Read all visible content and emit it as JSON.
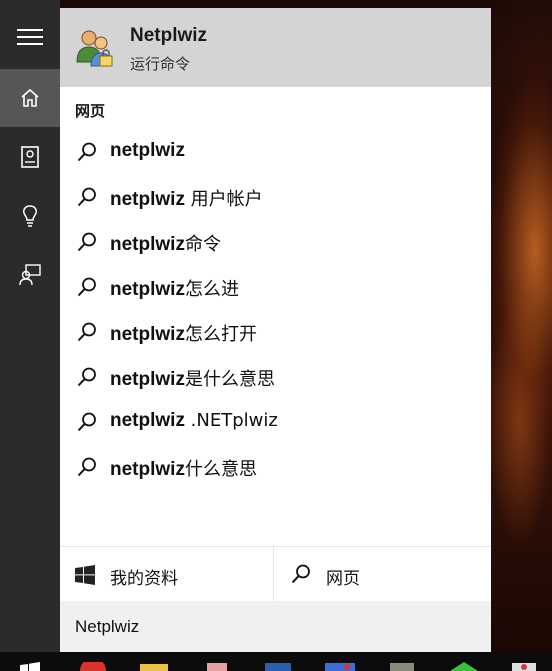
{
  "best_match": {
    "app_name": "Netplwiz",
    "app_type": "运行命令",
    "icon": "users-icon"
  },
  "section": {
    "header": "网页"
  },
  "suggestions": [
    {
      "bold": "netplwiz",
      "rest": ""
    },
    {
      "bold": "netplwiz",
      "rest": " 用户帐户"
    },
    {
      "bold": "netplwiz",
      "rest": "命令"
    },
    {
      "bold": "netplwiz",
      "rest": "怎么进"
    },
    {
      "bold": "netplwiz",
      "rest": "怎么打开"
    },
    {
      "bold": "netplwiz",
      "rest": "是什么意思"
    },
    {
      "bold": "netplwiz",
      "rest": " .NETplwiz"
    },
    {
      "bold": "netplwiz",
      "rest": "什么意思"
    }
  ],
  "bottom": {
    "my_stuff_label": "我的资料",
    "web_label": "网页"
  },
  "search": {
    "value": "Netplwiz"
  },
  "rail": {
    "items": [
      "hamburger-menu-icon",
      "home-icon",
      "notebook-icon",
      "lightbulb-icon",
      "feedback-icon"
    ]
  },
  "colors": {
    "rail_bg": "#2b2b2b",
    "rail_active": "#565656",
    "best_match_bg": "#d4d4d4",
    "search_bg": "#f0f0f0"
  }
}
